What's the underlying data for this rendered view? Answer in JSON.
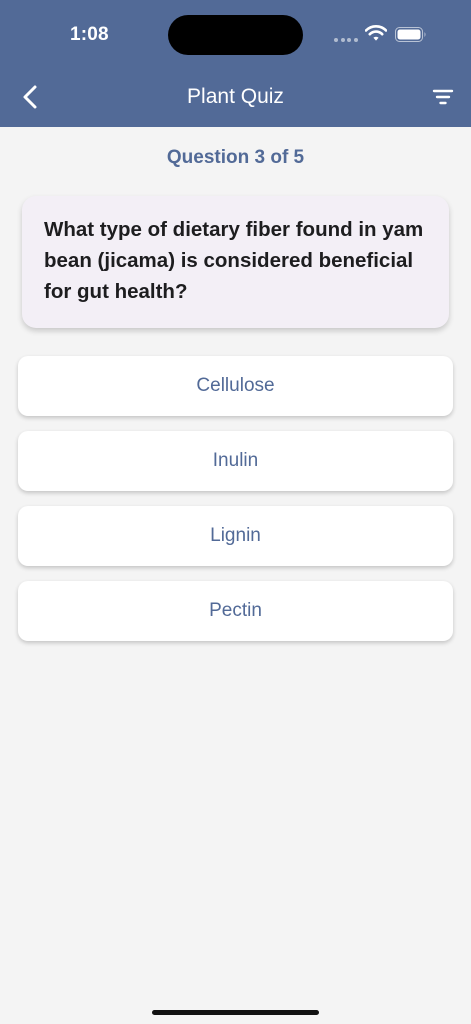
{
  "status_bar": {
    "time": "1:08"
  },
  "nav": {
    "title": "Plant Quiz",
    "back_icon": "chevron-left-icon",
    "filter_icon": "filter-icon"
  },
  "quiz": {
    "counter": "Question 3 of 5",
    "question": "What type of dietary fiber found in yam bean (jicama) is considered beneficial for gut health?",
    "answers": [
      "Cellulose",
      "Inulin",
      "Lignin",
      "Pectin"
    ]
  },
  "colors": {
    "primary": "#526a97",
    "card_background": "#f3eff6",
    "page_background": "#f4f4f4"
  }
}
